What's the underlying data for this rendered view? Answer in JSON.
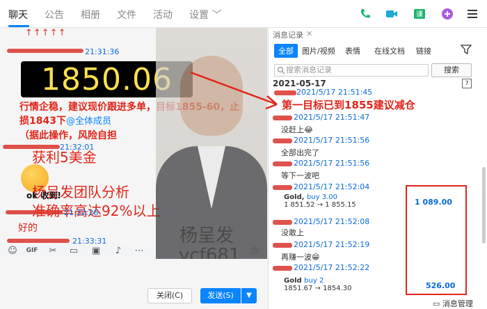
{
  "tabs": [
    {
      "label": "聊天",
      "active": true
    },
    {
      "label": "公告"
    },
    {
      "label": "相册"
    },
    {
      "label": "文件"
    },
    {
      "label": "活动"
    },
    {
      "label": "设置 ﹀"
    }
  ],
  "top_icons": [
    "phone-icon",
    "video-icon",
    "course-icon",
    "add-icon",
    "menu-icon"
  ],
  "chat": {
    "people_row": "↑↑↑↑↑",
    "time1": "21:31:36",
    "price": "1850.06",
    "advice": "行情企稳，建议现价跟进多单，目标1855-60，止损1843下",
    "mention": "@全体成员",
    "advice_tail": "（据此操作，风险自担",
    "time2": "21:32:01",
    "overlay_profit": "获利5美金",
    "overlay_team": "杨呈发团队分析",
    "overlay_rate": "准确率高达92%以上",
    "ok_text": "ok 收到!",
    "time3": "21:32:26",
    "good": "好的",
    "time4": "21:33:31"
  },
  "person": {
    "name": "杨呈发",
    "id": "ycf681"
  },
  "compose": {
    "close_label": "关闭(C)",
    "send_label": "发送(S)"
  },
  "history": {
    "title": "消息记录",
    "tabs": [
      "全部",
      "图片/视频",
      "表情",
      "在线文档",
      "链接"
    ],
    "search_placeholder": "搜索消息记录",
    "search_button": "搜索",
    "date": "2021-05-17",
    "calendar_day": "7",
    "headline": "第一目标已到1855建议减仓",
    "entries": [
      {
        "time": "2021/5/17 21:51:45"
      },
      {
        "time": "2021/5/17 21:51:47",
        "msg": "没赶上😂"
      },
      {
        "time": "2021/5/17 21:51:56",
        "msg": "全部出完了"
      },
      {
        "time": "2021/5/17 21:51:56",
        "msg": "等下一波吧"
      },
      {
        "time": "2021/5/17 21:52:04"
      },
      {
        "time": "2021/5/17 21:52:08",
        "msg": "没敢上"
      },
      {
        "time": "2021/5/17 21:52:19",
        "msg": "再赚一波😁"
      },
      {
        "time": "2021/5/17 21:52:22"
      }
    ],
    "gold1": {
      "title": "Gold,",
      "dir": "buy 3.00",
      "range": "1 851.52 → 1 855.15",
      "profit": "1 089.00"
    },
    "gold2": {
      "title": "Gold",
      "dir": "buy 2",
      "range": "1851.67 → 1854.30",
      "profit": "526.00"
    },
    "manage": "消息管理"
  }
}
